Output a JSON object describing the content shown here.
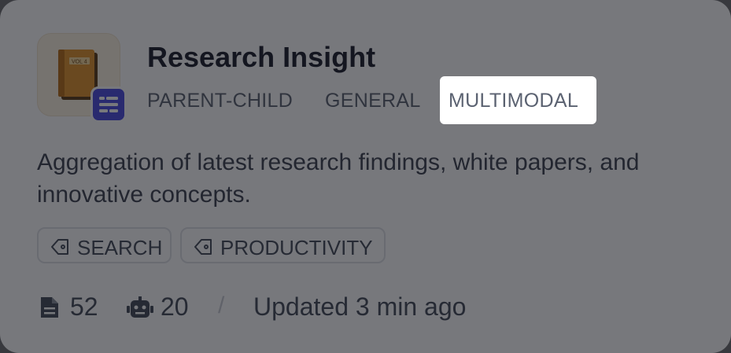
{
  "card": {
    "title": "Research Insight",
    "modes": [
      "PARENT-CHILD",
      "GENERAL",
      "MULTIMODAL"
    ],
    "highlighted_mode": "MULTIMODAL",
    "description": "Aggregation of latest research findings, white papers, and innovative concepts.",
    "tags": [
      "SEARCH",
      "PRODUCTIVITY"
    ],
    "stats": {
      "documents": "52",
      "apps": "20",
      "separator": "/",
      "updated": "Updated 3 min ago"
    },
    "icons": {
      "app": "book-icon",
      "badge": "list-icon",
      "tag": "tag-icon",
      "documents": "document-icon",
      "apps": "robot-icon"
    },
    "colors": {
      "badge": "#4b4ae2",
      "icon_bg": "#fdf3e2",
      "title": "#1a1d2a"
    }
  }
}
